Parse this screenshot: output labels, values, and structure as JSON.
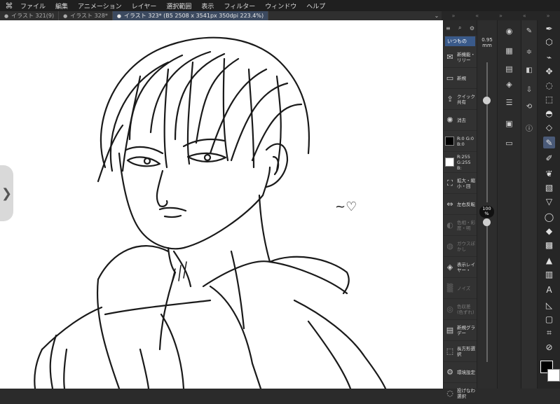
{
  "menu": {
    "items": [
      "ファイル",
      "編集",
      "アニメーション",
      "レイヤー",
      "選択範囲",
      "表示",
      "フィルター",
      "ウィンドウ",
      "ヘルプ"
    ]
  },
  "tabs": [
    {
      "label": "イラスト 321(9)"
    },
    {
      "label": "イラスト 328*"
    },
    {
      "label": "イラスト 323* (B5 2508 x 3541px 350dpi 223.4%)"
    }
  ],
  "command_bar": {
    "title": "いつもの",
    "commands": [
      {
        "label": "新機能・リリー",
        "icon": "new-feature-icon",
        "enabled": true
      },
      {
        "label": "新規",
        "icon": "new-file-icon",
        "enabled": true
      },
      {
        "label": "クイック共有",
        "icon": "share-icon",
        "enabled": true
      },
      {
        "label": "消去",
        "icon": "clear-icon",
        "enabled": true
      },
      {
        "label": "R:0 G:0 B:0",
        "icon": "black-swatch",
        "enabled": true
      },
      {
        "label": "R:255 G:255 B:",
        "icon": "white-swatch",
        "enabled": true
      },
      {
        "label": "拡大・縮小・回",
        "icon": "transform-icon",
        "enabled": true
      },
      {
        "label": "左右反転",
        "icon": "flip-icon",
        "enabled": true
      },
      {
        "label": "色相・彩度・明",
        "icon": "hue-icon",
        "enabled": false
      },
      {
        "label": "ガウスぼかし",
        "icon": "blur-icon",
        "enabled": false
      },
      {
        "label": "表示レイヤー・",
        "icon": "layer-merge-icon",
        "enabled": true
      },
      {
        "label": "ノイズ",
        "icon": "noise-icon",
        "enabled": false
      },
      {
        "label": "色収差(色ずれ)",
        "icon": "aberration-icon",
        "enabled": false
      },
      {
        "label": "新規グラデー",
        "icon": "gradient-icon",
        "enabled": true
      },
      {
        "label": "長方形選択",
        "icon": "rect-select-icon",
        "enabled": true
      },
      {
        "label": "環境設定",
        "icon": "settings-icon",
        "enabled": true
      },
      {
        "label": "投げなわ選択",
        "icon": "lasso-icon",
        "enabled": true
      }
    ]
  },
  "brush": {
    "size_value": "0.95",
    "size_unit": "mm",
    "size_fraction": 0.73,
    "opacity_value": "100",
    "opacity_unit": "%",
    "opacity_fraction": 1.0
  },
  "doodle": "~♡",
  "colors": {
    "accent": "#3a5a8a",
    "active_tab": "#3c4a60",
    "panel": "#323232",
    "canvas": "#ffffff",
    "main_color": "#000000",
    "sub_color": "#ffffff"
  }
}
